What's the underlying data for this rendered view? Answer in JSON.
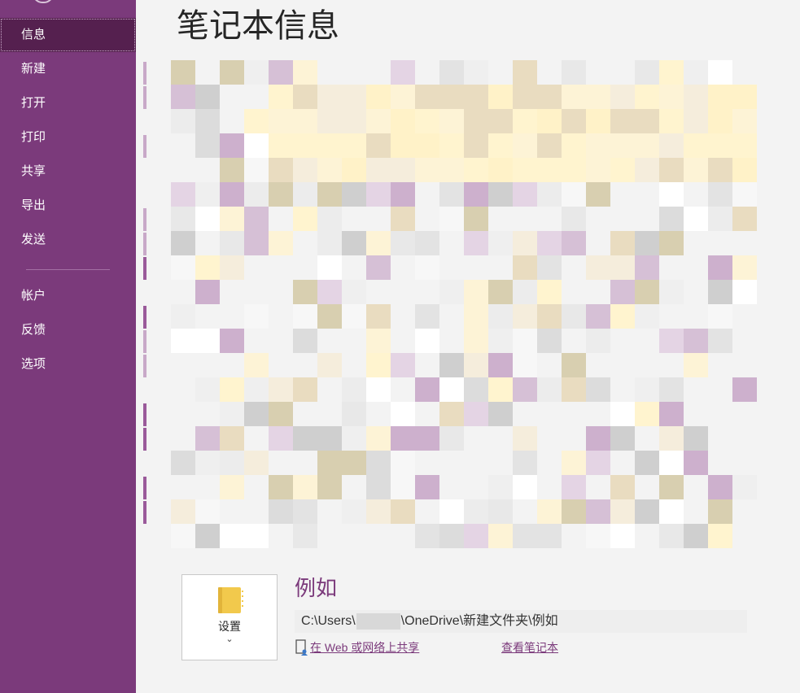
{
  "sidebar": {
    "items": [
      {
        "label": "信息",
        "selected": true
      },
      {
        "label": "新建"
      },
      {
        "label": "打开"
      },
      {
        "label": "打印"
      },
      {
        "label": "共享"
      },
      {
        "label": "导出"
      },
      {
        "label": "发送"
      }
    ],
    "bottom_items": [
      {
        "label": "帐户"
      },
      {
        "label": "反馈"
      },
      {
        "label": "选项"
      }
    ],
    "background": "#7b3a7b",
    "selected_background": "#55204f"
  },
  "main": {
    "title": "笔记本信息",
    "notebook": {
      "name": "例如",
      "settings_label": "设置",
      "path_prefix": "C:\\Users\\",
      "path_suffix": "\\OneDrive\\新建文件夹\\例如",
      "share_link": "在 Web 或网络上共享",
      "view_link": "查看笔记本",
      "icon": "notebook-icon",
      "icon_color": "#f2c94c",
      "accent": "#7b3a7b"
    }
  }
}
